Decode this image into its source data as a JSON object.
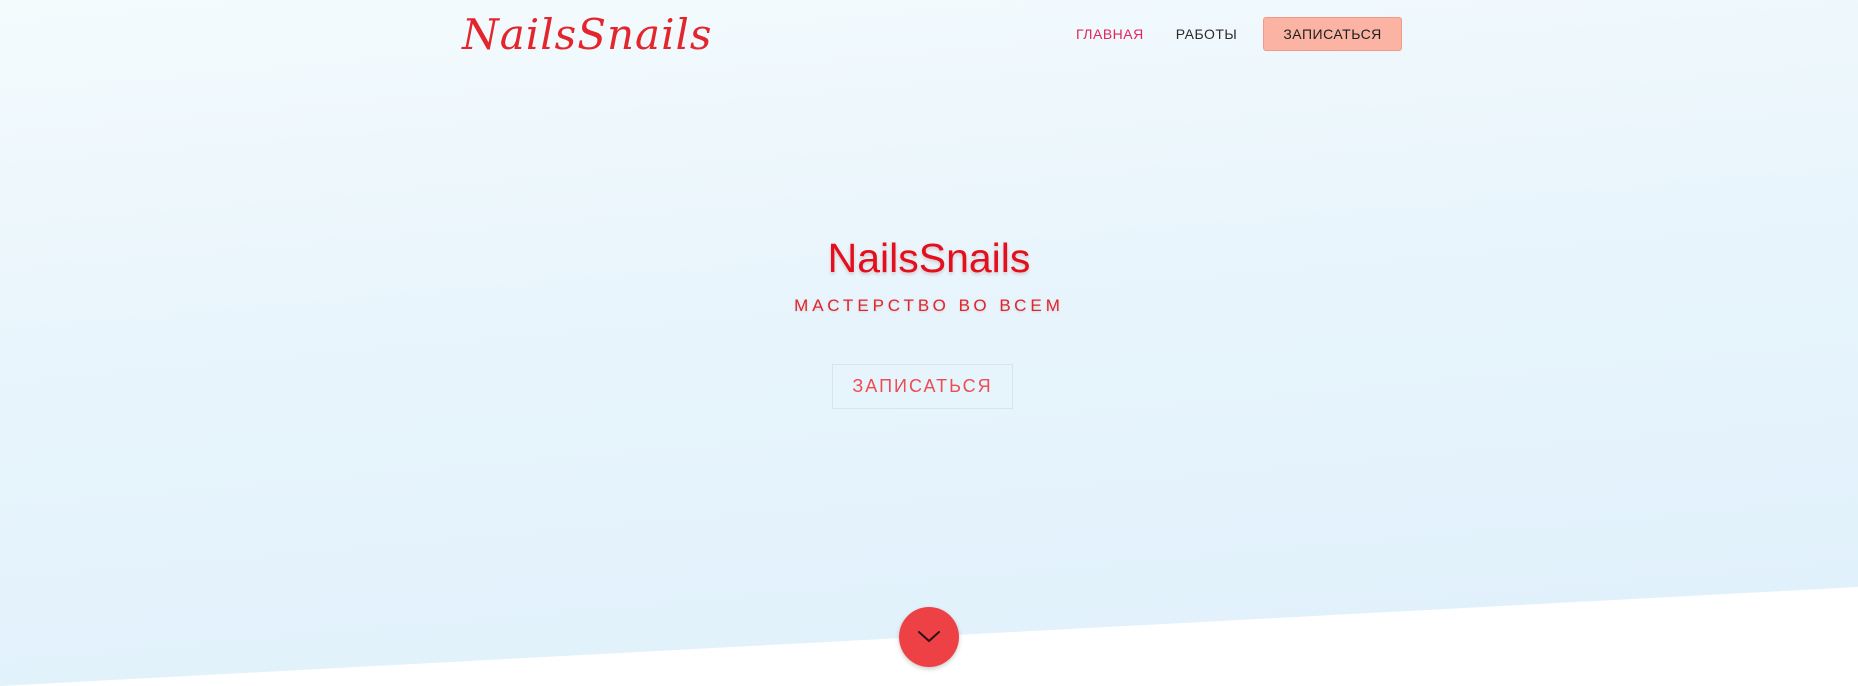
{
  "header": {
    "logo": "NailsSnails",
    "nav": [
      {
        "label": "ГЛАВНАЯ",
        "active": true
      },
      {
        "label": "РАБОТЫ",
        "active": false
      }
    ],
    "cta_label": "ЗАПИСАТЬСЯ"
  },
  "hero": {
    "title": "NailsSnails",
    "tagline": "МАСТЕРСТВО ВО ВСЕМ",
    "cta_label": "ЗАПИСАТЬСЯ"
  },
  "scroll_icon": "chevron-down-icon",
  "colors": {
    "brand_red": "#e30f1c",
    "nav_active": "#e4245b",
    "cta_bg": "#fbb3a3",
    "scroll_button": "#ee4146",
    "hero_bg": "#dff0fb"
  }
}
